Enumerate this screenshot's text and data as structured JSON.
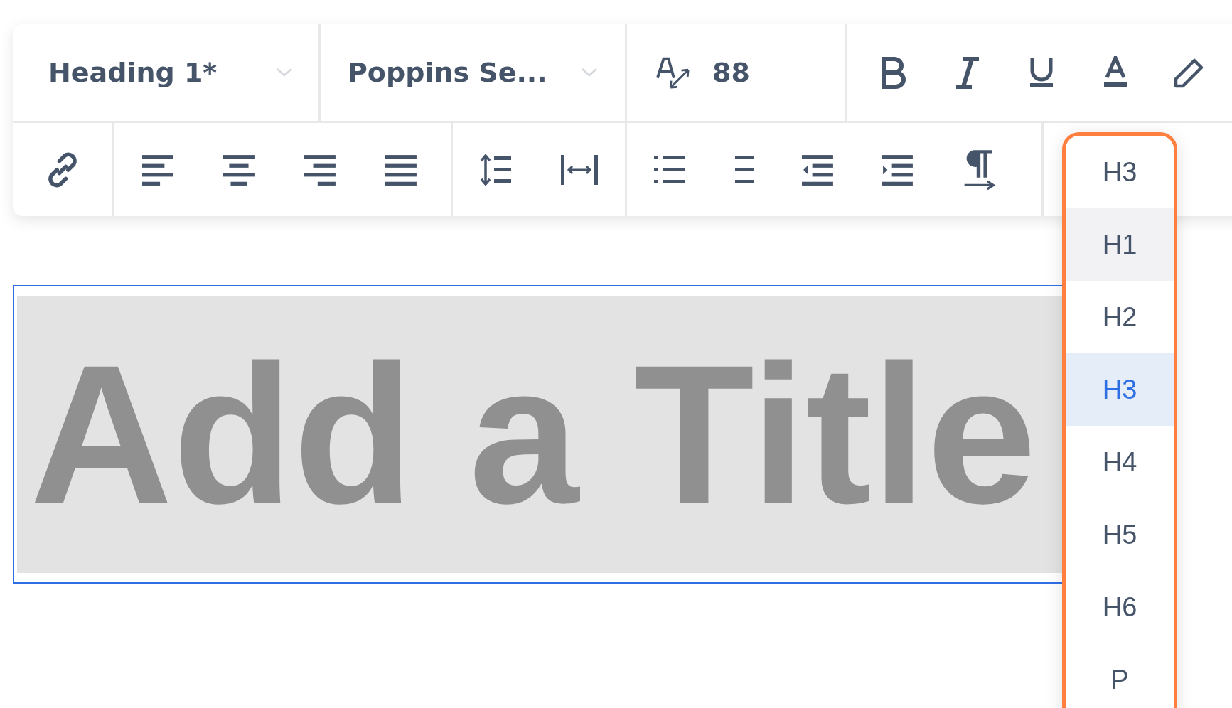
{
  "toolbar": {
    "text_style": {
      "value": "Heading 1*"
    },
    "font": {
      "value": "Poppins Se..."
    },
    "font_size": {
      "value": "88"
    }
  },
  "title_box": {
    "text": "Add a Title"
  },
  "heading_dropdown": {
    "current": "H3",
    "options": [
      {
        "label": "H1",
        "selected": false,
        "hovered": true
      },
      {
        "label": "H2",
        "selected": false,
        "hovered": false
      },
      {
        "label": "H3",
        "selected": true,
        "hovered": false
      },
      {
        "label": "H4",
        "selected": false,
        "hovered": false
      },
      {
        "label": "H5",
        "selected": false,
        "hovered": false
      },
      {
        "label": "H6",
        "selected": false,
        "hovered": false
      },
      {
        "label": "P",
        "selected": false,
        "hovered": false
      }
    ]
  }
}
